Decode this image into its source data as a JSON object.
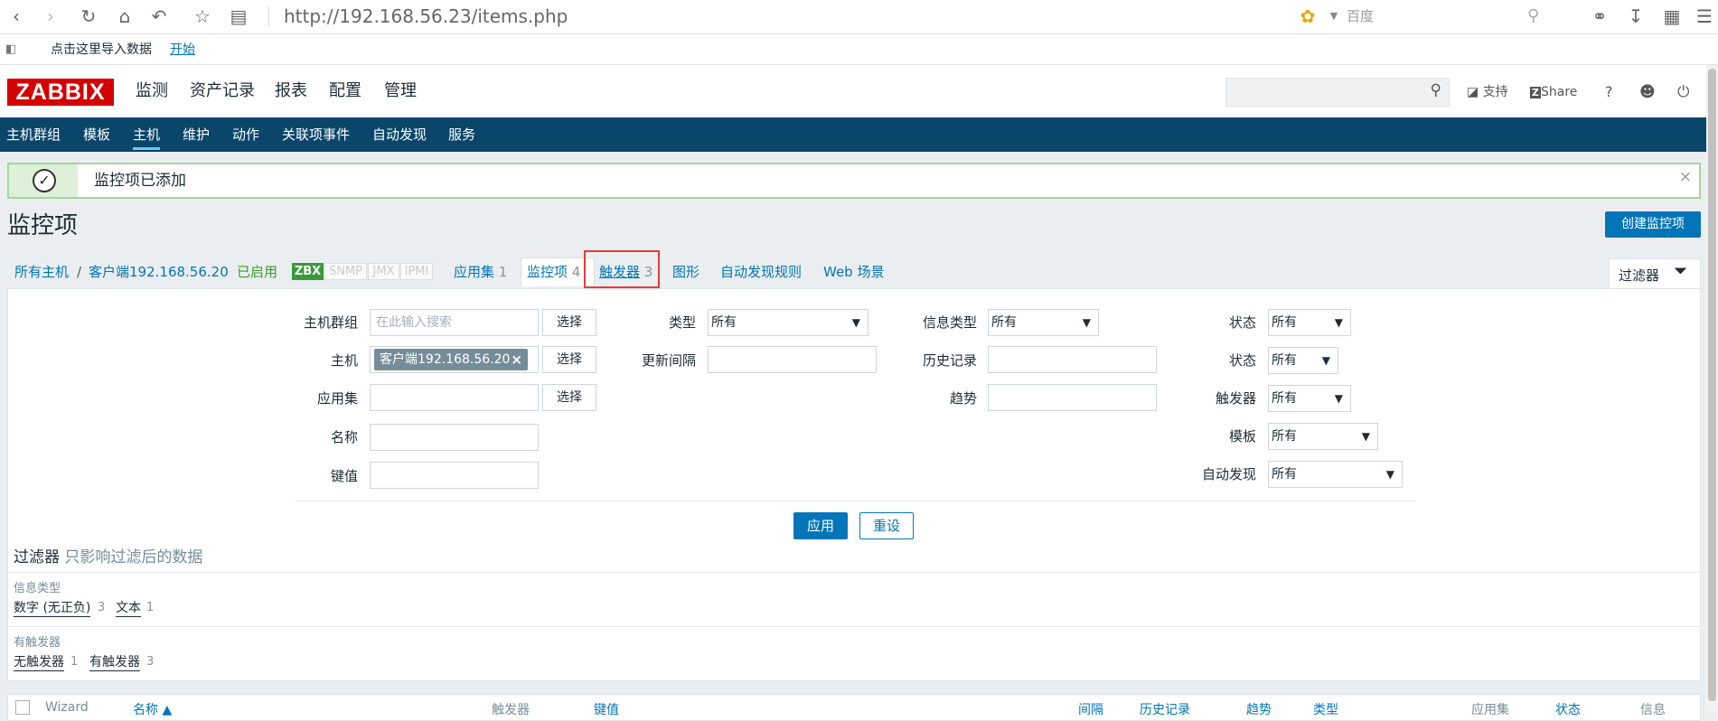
{
  "browser": {
    "url": "http://192.168.56.23/items.php",
    "search_placeholder": "百度"
  },
  "bookmarks": {
    "import_text": "点击这里导入数据",
    "start_link": "开始"
  },
  "logo": "ZABBIX",
  "main_menu": [
    "监测",
    "资产记录",
    "报表",
    "配置",
    "管理"
  ],
  "top_right": {
    "support": "支持",
    "share": "Share",
    "help": "?"
  },
  "sub_menu": [
    "主机群组",
    "模板",
    "主机",
    "维护",
    "动作",
    "关联项事件",
    "自动发现",
    "服务"
  ],
  "message": {
    "text": "监控项已添加",
    "close": "×"
  },
  "page": {
    "title": "监控项",
    "create_button": "创建监控项"
  },
  "breadcrumb": {
    "all_hosts": "所有主机",
    "slash": "/",
    "host": "客户端192.168.56.20",
    "enabled": "已启用",
    "zbx": "ZBX",
    "snmp": "SNMP",
    "jmx": "JMX",
    "ipmi": "IPMI",
    "applications": "应用集",
    "applications_count": "1",
    "items": "监控项",
    "items_count": "4",
    "triggers": "触发器",
    "triggers_count": "3",
    "graphs": "图形",
    "discovery": "自动发现规则",
    "web": "Web 场景"
  },
  "filter": {
    "tab_label": "过滤器",
    "host_group_label": "主机群组",
    "host_group_placeholder": "在此输入搜索",
    "select_label": "选择",
    "host_label": "主机",
    "host_chip": "客户端192.168.56.20",
    "chip_close": "×",
    "application_label": "应用集",
    "name_label": "名称",
    "key_label": "键值",
    "type_label": "类型",
    "type_value": "所有",
    "interval_label": "更新间隔",
    "info_type_label": "信息类型",
    "info_type_value": "所有",
    "history_label": "历史记录",
    "trends_label": "趋势",
    "state_label": "状态",
    "state_value": "所有",
    "status_label": "状态",
    "status_value": "所有",
    "triggers_label": "触发器",
    "triggers_value": "所有",
    "template_label": "模板",
    "template_value": "所有",
    "discovery_label": "自动发现",
    "discovery_value": "所有",
    "apply": "应用",
    "reset": "重设",
    "arrow": "▼"
  },
  "subfilter": {
    "title": "过滤器",
    "note": "只影响过滤后的数据",
    "info_type_title": "信息类型",
    "numeric": "数字 (无正负)",
    "numeric_count": "3",
    "text": "文本",
    "text_count": "1",
    "has_triggers_title": "有触发器",
    "no_triggers": "无触发器",
    "no_triggers_count": "1",
    "with_triggers": "有触发器",
    "with_triggers_count": "3"
  },
  "table_headers": {
    "wizard": "Wizard",
    "name": "名称 ▲",
    "triggers": "触发器",
    "key": "键值",
    "interval": "间隔",
    "history": "历史记录",
    "trends": "趋势",
    "type": "类型",
    "applications": "应用集",
    "status": "状态",
    "info": "信息"
  }
}
